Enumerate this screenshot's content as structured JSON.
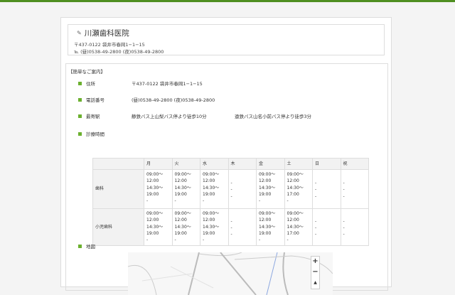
{
  "header": {
    "title": "川瀬歯科医院",
    "address": "〒437-0122 袋井市春岡1−1−15",
    "phone": "(昼)0538-49-2800 (夜)0538-49-2800"
  },
  "section_title": "【簡単なご案内】",
  "info": [
    {
      "label": "住所",
      "value": "〒437-0122 袋井市春岡1−1−15"
    },
    {
      "label": "電話番号",
      "value": "(昼)0538-49-2800 (夜)0538-49-2800"
    },
    {
      "label": "最寄駅",
      "value": "静鉄バス上山梨バス停より徒歩10分",
      "value2": "遠鉄バス山名小前バス停より徒歩3分"
    },
    {
      "label": "診療時間"
    }
  ],
  "schedule": {
    "days": [
      "月",
      "火",
      "水",
      "木",
      "金",
      "土",
      "日",
      "祝"
    ],
    "rows": [
      {
        "name": "歯科",
        "cells": [
          "09:00〜\n12:00\n14:30〜\n19:00\n-",
          "09:00〜\n12:00\n14:30〜\n19:00\n-",
          "09:00〜\n12:00\n14:30〜\n19:00\n-",
          "-\n-\n-",
          "09:00〜\n12:00\n14:30〜\n19:00\n-",
          "09:00〜\n12:00\n14:30〜\n17:00\n-",
          "-\n-\n-",
          "-\n-\n-"
        ]
      },
      {
        "name": "小児歯科",
        "cells": [
          "09:00〜\n12:00\n14:30〜\n19:00\n-",
          "09:00〜\n12:00\n14:30〜\n19:00\n-",
          "09:00〜\n12:00\n14:30〜\n19:00\n-",
          "-\n-\n-",
          "09:00〜\n12:00\n14:30〜\n19:00\n-",
          "09:00〜\n12:00\n14:30〜\n17:00\n-",
          "-\n-\n-",
          "-\n-\n-"
        ]
      }
    ]
  },
  "map": {
    "label": "地図",
    "zoom_in": "+",
    "zoom_out": "−",
    "north": "▲"
  },
  "colors": {
    "accent": "#6bb02f",
    "topbar": "#4f8f21"
  }
}
